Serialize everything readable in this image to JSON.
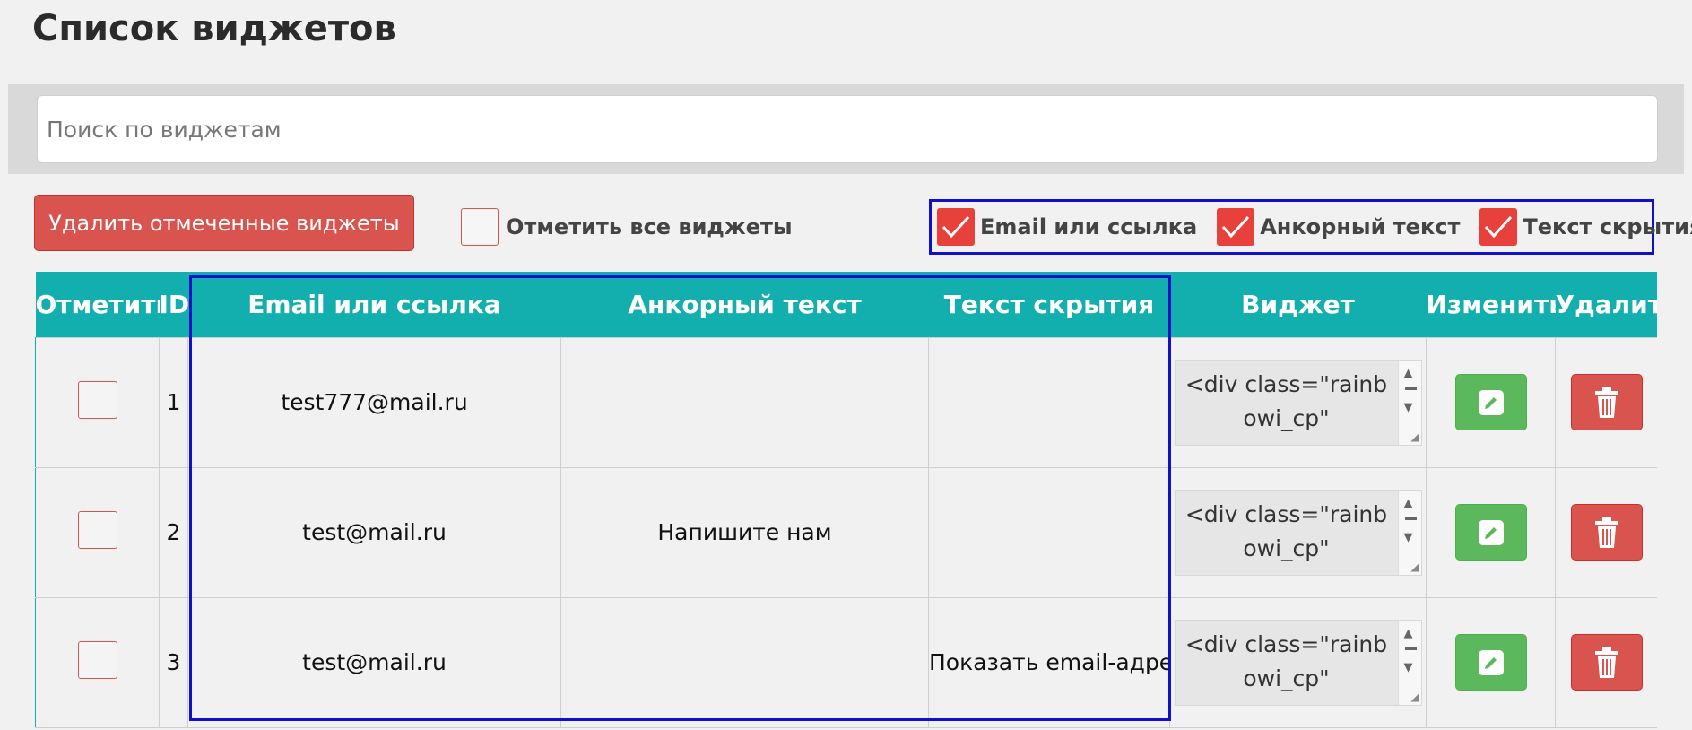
{
  "page": {
    "title": "Список виджетов"
  },
  "search": {
    "placeholder": "Поиск по виджетам",
    "value": ""
  },
  "toolbar": {
    "delete_checked_label": "Удалить отмеченные виджеты",
    "check_all_label": "Отметить все виджеты"
  },
  "column_toggles": [
    {
      "label": "Email или ссылка",
      "checked": true
    },
    {
      "label": "Анкорный текст",
      "checked": true
    },
    {
      "label": "Текст скрытия",
      "checked": true
    }
  ],
  "table": {
    "headers": {
      "select": "Отметить",
      "id": "ID",
      "email": "Email или ссылка",
      "anchor": "Анкорный текст",
      "hide_text": "Текст скрытия",
      "widget": "Виджет",
      "edit": "Изменить",
      "delete": "Удалить"
    },
    "rows": [
      {
        "id": "1",
        "email": "test777@mail.ru",
        "anchor": "",
        "hide_text": "",
        "widget_code": "<div class=\"rainbowi_cp\""
      },
      {
        "id": "2",
        "email": "test@mail.ru",
        "anchor": "Напишите нам",
        "hide_text": "",
        "widget_code": "<div class=\"rainbowi_cp\""
      },
      {
        "id": "3",
        "email": "test@mail.ru",
        "anchor": "",
        "hide_text": "Показать email-адрес",
        "widget_code": "<div class=\"rainbowi_cp\""
      }
    ]
  },
  "colors": {
    "header_teal": "#13aeae",
    "danger_red": "#d9534f",
    "success_green": "#5cb85c",
    "highlight_blue": "#1010cc",
    "checkbox_checked": "#e8413c"
  }
}
